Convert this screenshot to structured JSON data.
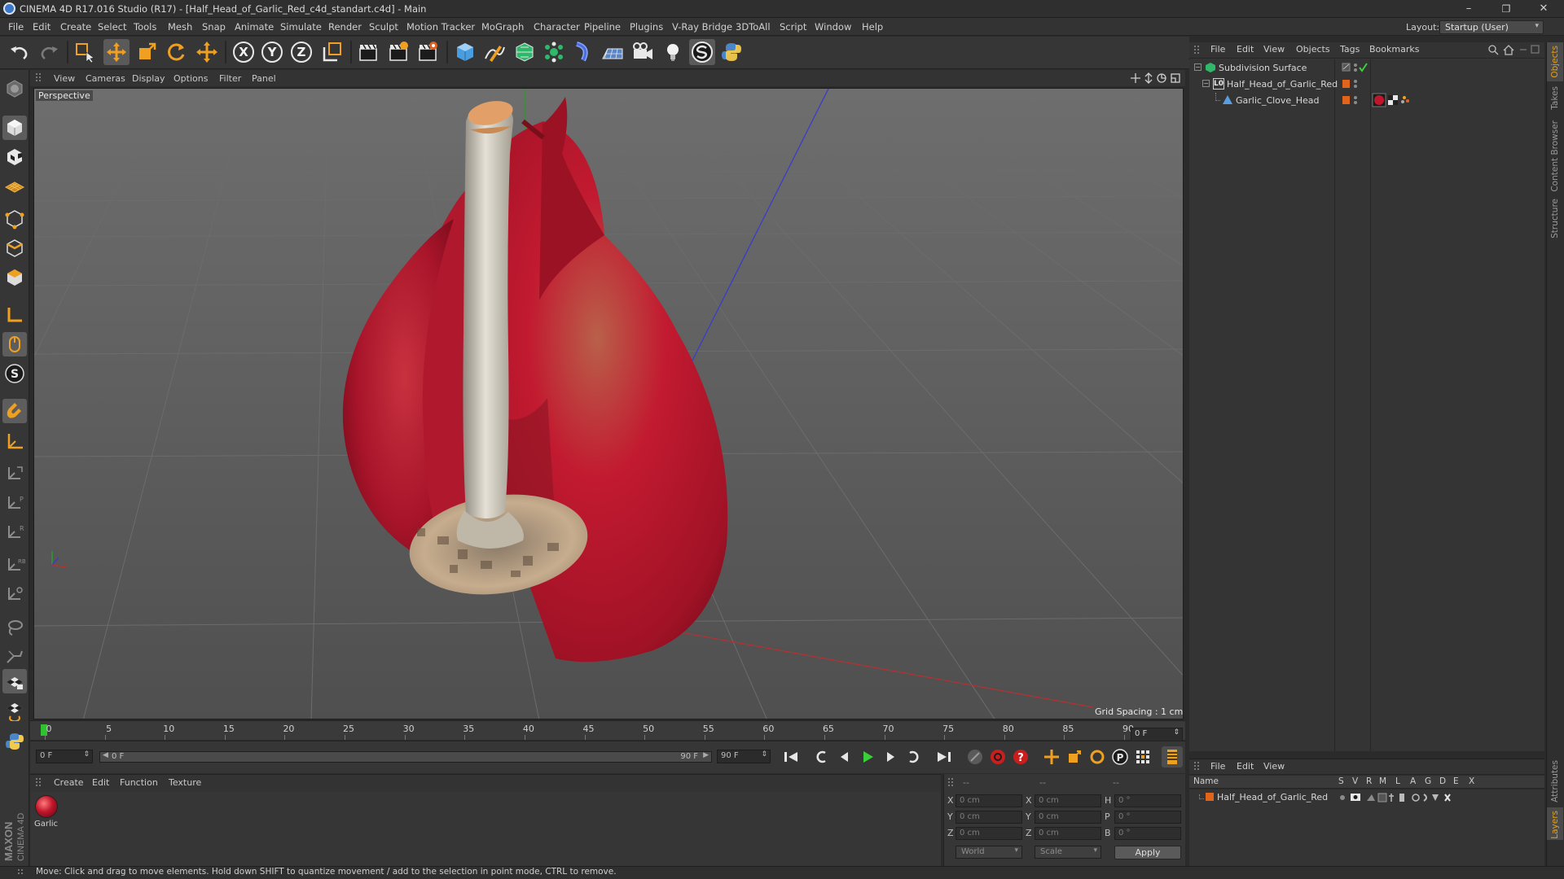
{
  "window": {
    "title": "CINEMA 4D R17.016 Studio (R17) - [Half_Head_of_Garlic_Red_c4d_standart.c4d] - Main",
    "minimize": "–",
    "restore": "❐",
    "close": "✕"
  },
  "menubar": {
    "items": [
      "File",
      "Edit",
      "Create",
      "Select",
      "Tools",
      "Mesh",
      "Snap",
      "Animate",
      "Simulate",
      "Render",
      "Sculpt",
      "Motion Tracker",
      "MoGraph",
      "Character",
      "Pipeline",
      "Plugins",
      "V-Ray Bridge",
      "3DToAll",
      "Script",
      "Window",
      "Help"
    ],
    "layout_label": "Layout:",
    "layout_value": "Startup (User)"
  },
  "toolbar": {
    "axis_x": "X",
    "axis_y": "Y",
    "axis_z": "Z"
  },
  "viewport": {
    "menus": [
      "View",
      "Cameras",
      "Display",
      "Options",
      "Filter",
      "Panel"
    ],
    "label": "Perspective",
    "grid_spacing": "Grid Spacing : 1 cm"
  },
  "timeline": {
    "ticks": [
      "0",
      "5",
      "10",
      "15",
      "20",
      "25",
      "30",
      "35",
      "40",
      "45",
      "50",
      "55",
      "60",
      "65",
      "70",
      "75",
      "80",
      "85",
      "90"
    ],
    "current_frame_box": "0 F"
  },
  "transport": {
    "start_field": "0 F",
    "range_start": "0 F",
    "range_end": "90 F",
    "end_field": "90 F"
  },
  "material_manager": {
    "menus": [
      "Create",
      "Edit",
      "Function",
      "Texture"
    ],
    "materials": [
      {
        "name": "Garlic"
      }
    ]
  },
  "coordinates": {
    "header": [
      "--",
      "--",
      "--"
    ],
    "rows": [
      {
        "axis": "X",
        "pos": "0 cm",
        "axis2": "X",
        "size": "0 cm",
        "rot_axis": "H",
        "rot": "0 °"
      },
      {
        "axis": "Y",
        "pos": "0 cm",
        "axis2": "Y",
        "size": "0 cm",
        "rot_axis": "P",
        "rot": "0 °"
      },
      {
        "axis": "Z",
        "pos": "0 cm",
        "axis2": "Z",
        "size": "0 cm",
        "rot_axis": "B",
        "rot": "0 °"
      }
    ],
    "mode_select": "World",
    "scale_select": "Scale",
    "apply": "Apply"
  },
  "object_manager": {
    "menus": [
      "File",
      "Edit",
      "View",
      "Objects",
      "Tags",
      "Bookmarks"
    ],
    "objects": [
      {
        "name": "Subdivision Surface"
      },
      {
        "name": "Half_Head_of_Garlic_Red"
      },
      {
        "name": "Garlic_Clove_Head"
      }
    ]
  },
  "side_tabs": [
    "Objects",
    "Takes",
    "Content Browser",
    "Structure",
    "Attributes",
    "Layers"
  ],
  "layer_manager": {
    "menus": [
      "File",
      "Edit",
      "View"
    ],
    "columns": [
      "Name",
      "S",
      "V",
      "R",
      "M",
      "L",
      "A",
      "G",
      "D",
      "E",
      "X"
    ],
    "layers": [
      {
        "name": "Half_Head_of_Garlic_Red"
      }
    ]
  },
  "status": {
    "text": "Move: Click and drag to move elements. Hold down SHIFT to quantize movement / add to the selection in point mode, CTRL to remove."
  },
  "branding": {
    "maxon": "MAXON",
    "cinema": "CINEMA 4D"
  },
  "colors": {
    "accent_orange": "#f0a020",
    "garlic_red": "#c0162c",
    "ui_bg": "#363636",
    "viewport_bg": "#5b5b5b"
  }
}
